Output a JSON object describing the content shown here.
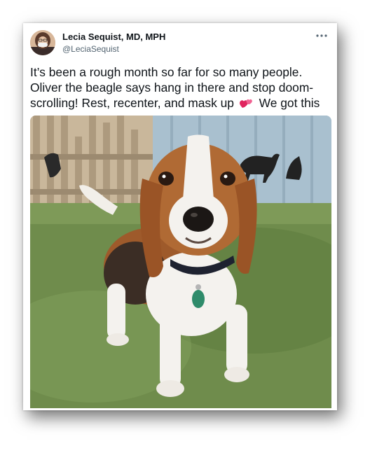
{
  "tweet": {
    "author_name": "Lecia Sequist, MD, MPH",
    "author_handle": "@LeciaSequist",
    "more_icon": "more-horizontal-icon",
    "text_line1": "It’s been a rough month so far for so many people.",
    "text_line2": "Oliver the beagle says hang in there and stop doom-",
    "text_line3_before_emoji": "scrolling! Rest, recenter, and mask up",
    "text_line3_emoji": "two-hearts-emoji",
    "text_line3_after_emoji": "We got this",
    "media": "beagle puppy photo"
  },
  "colors": {
    "text": "#0f1419",
    "secondary_text": "#536471",
    "heart": "#e0245e"
  }
}
